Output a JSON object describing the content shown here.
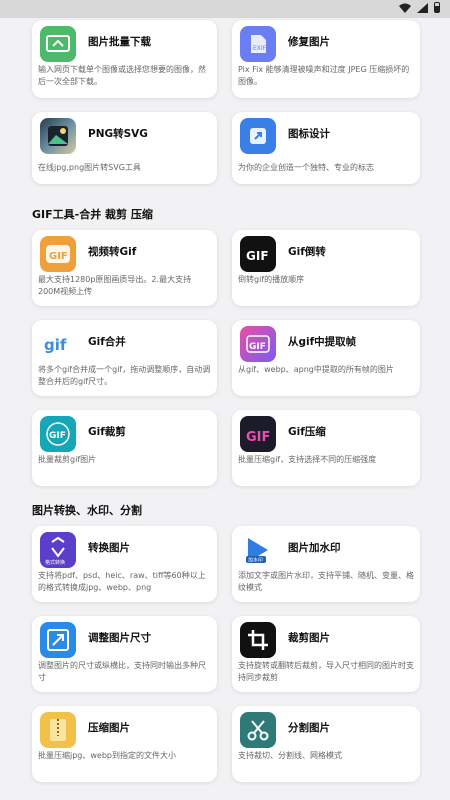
{
  "colors": {
    "background": "#f2f2f4",
    "card": "#ffffff",
    "title": "#111111",
    "desc": "#666666"
  },
  "groups": [
    {
      "title": "",
      "items": [
        {
          "title": "图片批量下载",
          "desc": "输入网页下载单个图像或选择您想要的图像，然后一次全部下载。",
          "icon": "image-download-icon"
        },
        {
          "title": "修复图片",
          "desc": "Pix Fix 能够清理被噪声和过度 JPEG 压缩损坏的图像。",
          "icon": "exif-image-icon"
        },
        {
          "title": "PNG转SVG",
          "desc": "在线jpg,png图片转SVG工具",
          "icon": "png-to-svg-icon"
        },
        {
          "title": "图标设计",
          "desc": "为你的企业创造一个独特、专业的标志",
          "icon": "logo-design-icon"
        }
      ]
    },
    {
      "title": "GIF工具-合并 裁剪 压缩",
      "items": [
        {
          "title": "视频转Gif",
          "desc": "最大支持1280p原图画质导出。2.最大支持200M视频上传",
          "icon": "video-to-gif-icon",
          "badge": "GIF"
        },
        {
          "title": "Gif倒转",
          "desc": "倒转gif的播放顺序",
          "icon": "gif-reverse-icon",
          "badge": "GIF"
        },
        {
          "title": "Gif合并",
          "desc": "将多个gif合并成一个gif，拖动调整顺序，自动调整合并后的gif尺寸。",
          "icon": "gif-merge-icon",
          "badge": "gif"
        },
        {
          "title": "从gif中提取帧",
          "desc": "从gif、webp、apng中提取的所有帧的图片",
          "icon": "gif-extract-frames-icon",
          "badge": "GIF"
        },
        {
          "title": "Gif裁剪",
          "desc": "批量裁剪gif图片",
          "icon": "gif-crop-icon",
          "badge": "GIF"
        },
        {
          "title": "Gif压缩",
          "desc": "批量压缩gif，支持选择不同的压缩强度",
          "icon": "gif-compress-icon",
          "badge": "GIF"
        }
      ]
    },
    {
      "title": "图片转换、水印、分割",
      "items": [
        {
          "title": "转换图片",
          "desc": "支持将pdf、psd、heic、raw、tiff等60种以上的格式转换成jpg、webp、png",
          "icon": "convert-format-icon",
          "badge": "格式转换"
        },
        {
          "title": "图片加水印",
          "desc": "添加文字或图片水印，支持平铺、随机、变量、格纹模式",
          "icon": "watermark-icon",
          "badge": "加水印"
        },
        {
          "title": "调整图片尺寸",
          "desc": "调整图片的尺寸或纵横比，支持同时输出多种尺寸",
          "icon": "resize-icon"
        },
        {
          "title": "裁剪图片",
          "desc": "支持旋转或翻转后裁剪，导入尺寸相同的图片时支持同步裁剪",
          "icon": "crop-icon"
        },
        {
          "title": "压缩图片",
          "desc": "批量压缩jpg、webp到指定的文件大小",
          "icon": "compress-icon"
        },
        {
          "title": "分割图片",
          "desc": "支持裁切、分割线、网格模式",
          "icon": "scissors-icon"
        }
      ]
    }
  ]
}
